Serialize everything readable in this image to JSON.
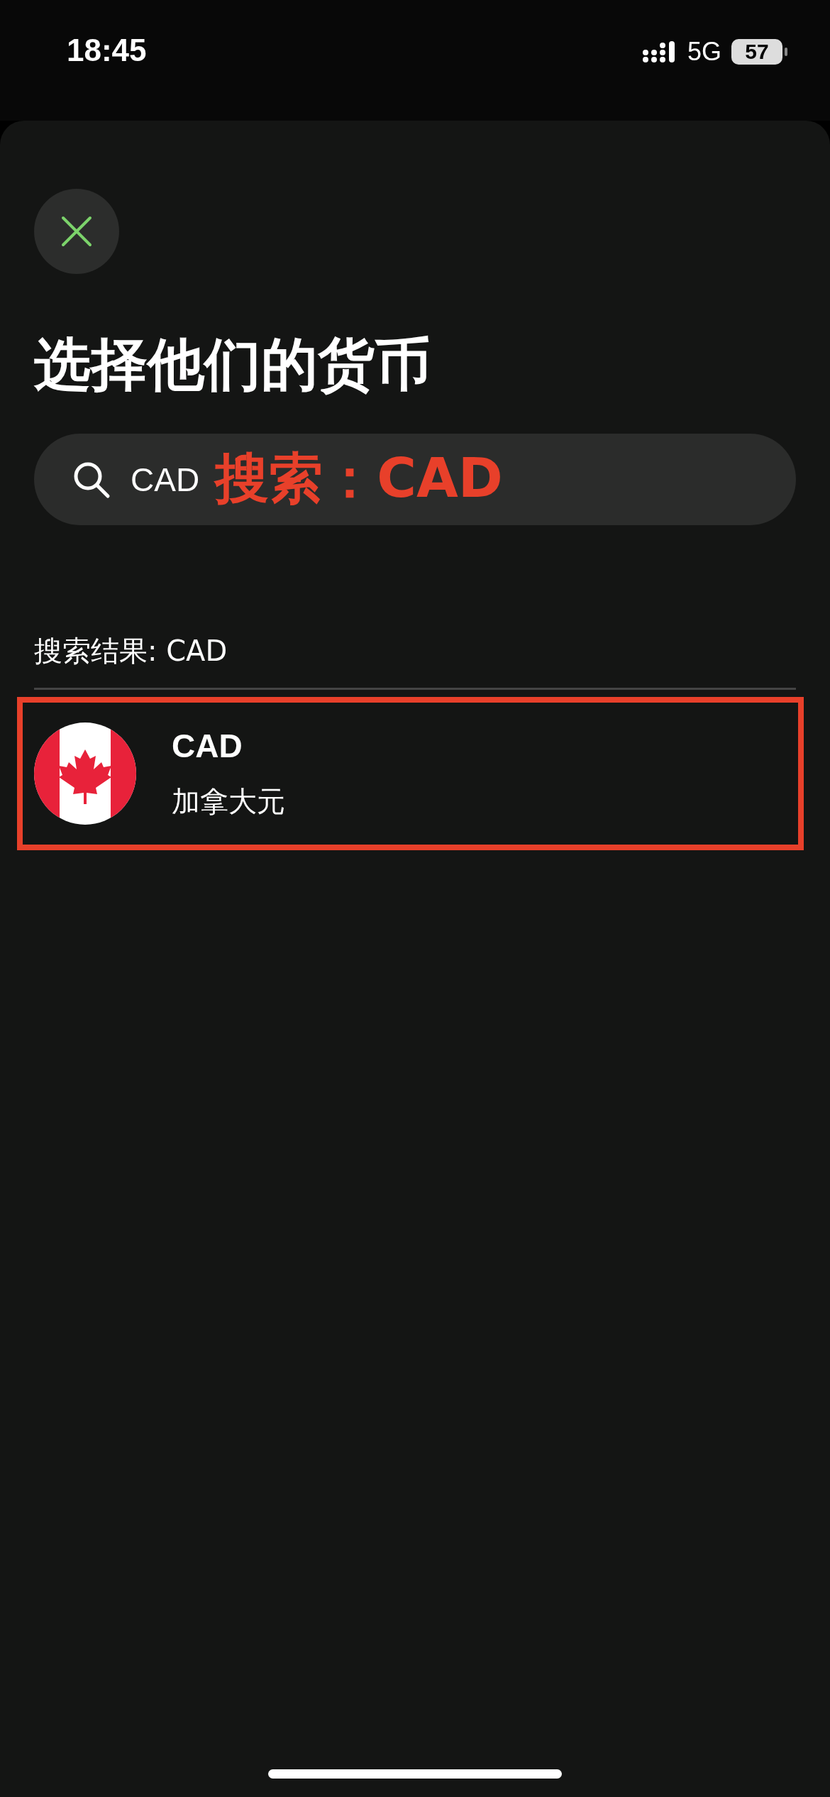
{
  "status_bar": {
    "time": "18:45",
    "network": "5G",
    "battery": "57"
  },
  "title": "选择他们的货币",
  "search": {
    "value": "CAD"
  },
  "annotation": {
    "label": "搜索：CAD"
  },
  "results": {
    "heading": "搜索结果: CAD",
    "items": [
      {
        "code": "CAD",
        "name": "加拿大元",
        "highlighted": true
      }
    ]
  }
}
